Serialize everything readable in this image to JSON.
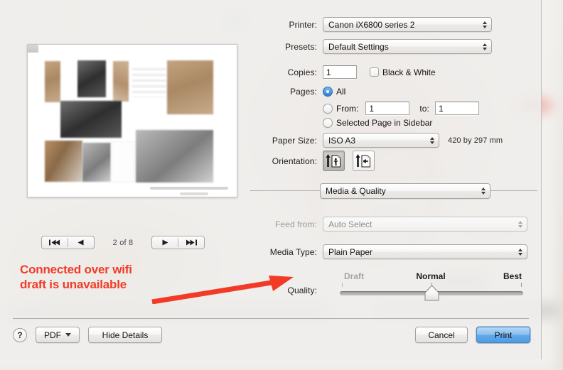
{
  "dialog": {
    "printer": {
      "label": "Printer:",
      "value": "Canon iX6800 series 2"
    },
    "presets": {
      "label": "Presets:",
      "value": "Default Settings"
    },
    "copies": {
      "label": "Copies:",
      "value": "1"
    },
    "black_and_white": {
      "label": "Black & White",
      "checked": false
    },
    "pages": {
      "label": "Pages:",
      "options": [
        {
          "label": "All",
          "selected": true
        },
        {
          "label": "From:",
          "selected": false
        },
        {
          "label": "Selected Page in Sidebar",
          "selected": false
        }
      ],
      "from_value": "1",
      "to_label": "to:",
      "to_value": "1"
    },
    "paper_size": {
      "label": "Paper Size:",
      "value": "ISO A3",
      "dimensions": "420 by 297 mm"
    },
    "orientation": {
      "label": "Orientation:",
      "buttons": [
        {
          "name": "portrait-orientation",
          "selected": true
        },
        {
          "name": "landscape-orientation",
          "selected": false
        }
      ]
    },
    "pane_selector": {
      "value": "Media & Quality"
    },
    "feed_from": {
      "label": "Feed from:",
      "value": "Auto Select",
      "disabled": true
    },
    "media_type": {
      "label": "Media Type:",
      "value": "Plain Paper"
    },
    "quality": {
      "label": "Quality:",
      "ticks": [
        {
          "label": "Draft",
          "disabled": true,
          "position": 0
        },
        {
          "label": "Normal",
          "disabled": false,
          "position": 0.5
        },
        {
          "label": "Best",
          "disabled": false,
          "position": 1
        }
      ],
      "value": "Normal",
      "thumb_position": 0.5
    }
  },
  "preview": {
    "page_counter": "2 of 8",
    "nav": {
      "first_label": "first-page",
      "prev_label": "previous-page",
      "next_label": "next-page",
      "last_label": "last-page"
    }
  },
  "annotation": {
    "text": "Connected over wifi\ndraft is unavailable",
    "color": "#f23b26"
  },
  "buttons": {
    "help": "?",
    "pdf": "PDF",
    "hide_details": "Hide Details",
    "cancel": "Cancel",
    "print": "Print"
  }
}
